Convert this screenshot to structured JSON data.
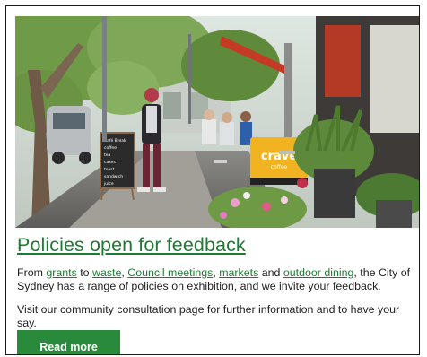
{
  "article": {
    "headline": "Policies open for feedback",
    "paragraph1": {
      "prefix": "From ",
      "link1": "grants",
      "sep1": " to ",
      "link2": "waste",
      "sep2": ", ",
      "link3": "Council meetings",
      "sep3": ", ",
      "link4": "markets",
      "sep4": " and ",
      "link5": "outdoor dining",
      "suffix": ", the City of Sydney has a range of policies on exhibition, and we invite your feedback."
    },
    "paragraph2": "Visit our community consultation page for further information and to have your say.",
    "button_label": "Read more"
  },
  "photo": {
    "cafe_brand": "crave",
    "cafe_sub": "coffee",
    "board_lines": [
      "Café Break",
      "coffee",
      "tea",
      "cakes",
      "toast",
      "sandwich",
      "juice"
    ]
  },
  "colors": {
    "link_green": "#1e7b34",
    "button_green": "#2a8a3c"
  }
}
